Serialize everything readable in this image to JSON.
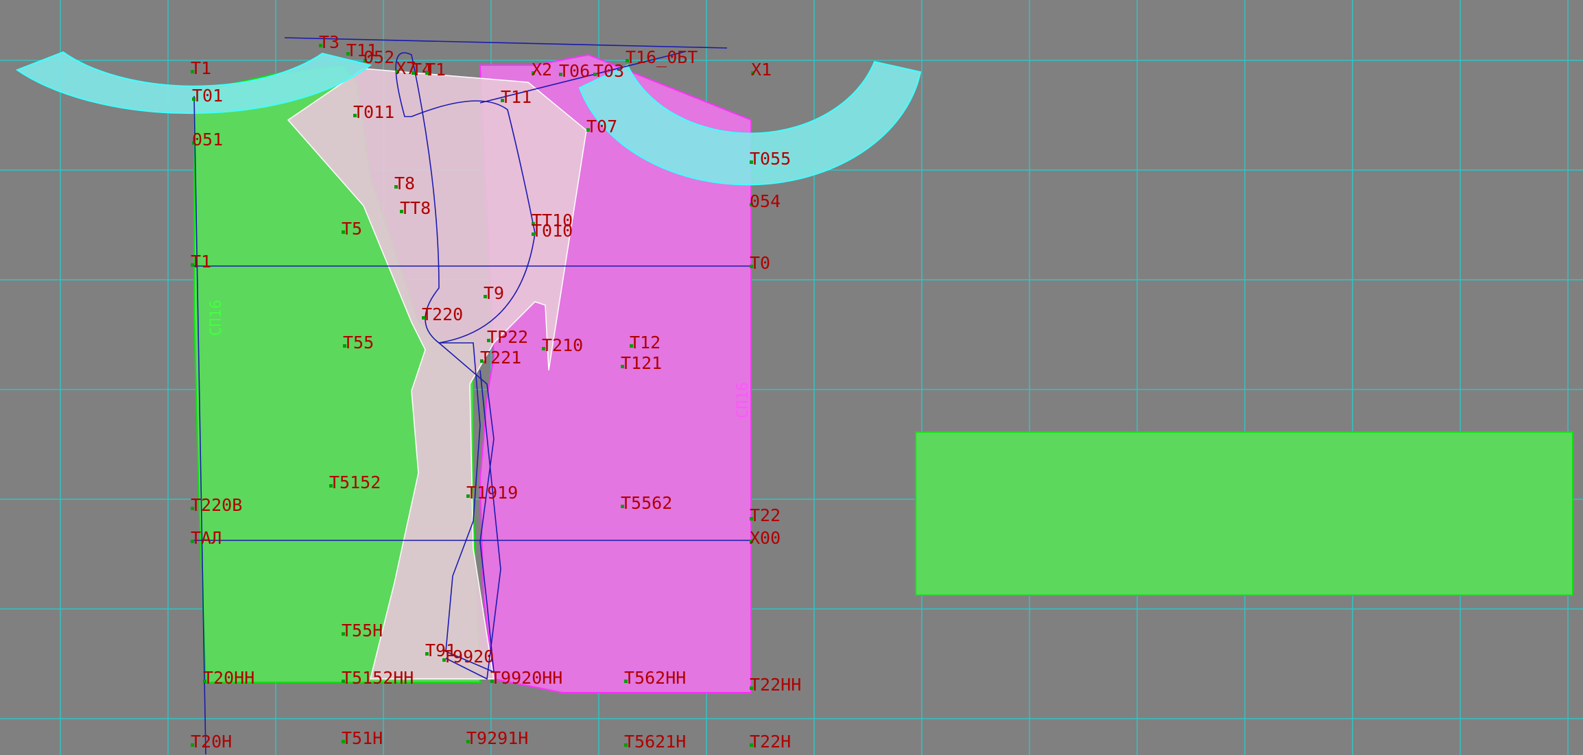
{
  "colors": {
    "background": "#808080",
    "grid": "#2fc4c4",
    "piece_back": "#5cd85c",
    "piece_front": "#e376e0",
    "piece_sleeve": "#e8c8d8",
    "piece_collar": "#7fe8e8",
    "piece_band": "#5cd85c",
    "pattern_line": "#1a1ab0",
    "label": "#b00000",
    "point_marker": "#00a000"
  },
  "seam_labels": [
    "СП16",
    "СП16"
  ],
  "point_labels": [
    "Т1",
    "Т01",
    "051",
    "Т3",
    "Т11",
    "052",
    "Х7",
    "Т4",
    "Т1",
    "Х2",
    "Т06",
    "Т03",
    "Т16_0БТ",
    "Х1",
    "Т011",
    "Т11",
    "Т07",
    "Т055",
    "054",
    "Т8",
    "ТТ8",
    "Т5",
    "ТТ10",
    "Т010",
    "Т1",
    "Т0",
    "Т9",
    "Т220",
    "Т55",
    "ТР22",
    "Т210",
    "Т12",
    "Т221",
    "Т121",
    "Т5152",
    "Т22",
    "Т220В",
    "Т1919",
    "Т5562",
    "ТАЛ",
    "Х00",
    "Т55Н",
    "Т91",
    "Т9920",
    "Т20НН",
    "Т5152НН",
    "Т9920НН",
    "Т562НН",
    "Т22НН",
    "Т20Н",
    "Т51Н",
    "Т9291Н",
    "Т5621Н",
    "Т22Н"
  ]
}
